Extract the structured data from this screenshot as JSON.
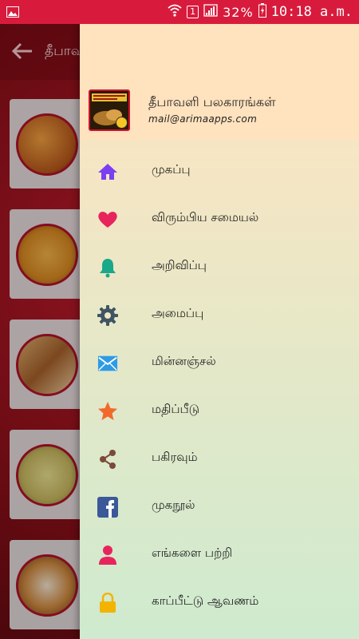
{
  "status_bar": {
    "sim_number": "1",
    "battery": "32%",
    "time": "10:18 a.m."
  },
  "background": {
    "title": "தீபாவ"
  },
  "drawer": {
    "app_name": "தீபாவளி பலகாரங்கள்",
    "email": "mail@arimaapps.com",
    "items": [
      {
        "label": "முகப்பு",
        "icon": "home-icon",
        "color": "#7b3ff2"
      },
      {
        "label": "விரும்பிய சமையல்",
        "icon": "heart-icon",
        "color": "#e8245c"
      },
      {
        "label": "அறிவிப்பு",
        "icon": "bell-icon",
        "color": "#1aa88a"
      },
      {
        "label": "அமைப்பு",
        "icon": "gear-icon",
        "color": "#3f5563"
      },
      {
        "label": "மின்னஞ்சல்",
        "icon": "mail-icon",
        "color": "#2e9be6"
      },
      {
        "label": "மதிப்பீடு",
        "icon": "star-icon",
        "color": "#f26a2b"
      },
      {
        "label": "பகிரவும்",
        "icon": "share-icon",
        "color": "#7a4a3a"
      },
      {
        "label": "முகநூல்",
        "icon": "facebook-icon",
        "color": "#3b5998"
      },
      {
        "label": "எங்களை பற்றி",
        "icon": "person-icon",
        "color": "#e8245c"
      },
      {
        "label": "காப்பீட்டு ஆவணம்",
        "icon": "lock-icon",
        "color": "#f2b400"
      }
    ]
  },
  "colors": {
    "status_bar": "#d81b3c",
    "drawer_header": "#ffe2be",
    "scrim_base": "#8e1019"
  }
}
